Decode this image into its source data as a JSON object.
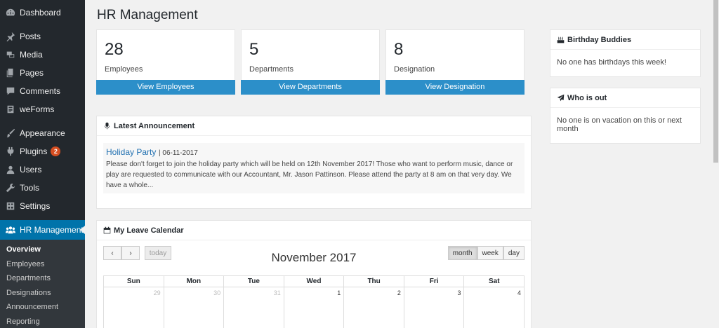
{
  "sidebar": {
    "items": [
      {
        "label": "Dashboard",
        "icon": "dashboard-icon"
      },
      {
        "label": "Posts",
        "icon": "pin-icon"
      },
      {
        "label": "Media",
        "icon": "media-icon"
      },
      {
        "label": "Pages",
        "icon": "pages-icon"
      },
      {
        "label": "Comments",
        "icon": "comment-icon"
      },
      {
        "label": "weForms",
        "icon": "weforms-icon"
      },
      {
        "label": "Appearance",
        "icon": "brush-icon"
      },
      {
        "label": "Plugins",
        "icon": "plugin-icon",
        "badge": "2"
      },
      {
        "label": "Users",
        "icon": "user-icon"
      },
      {
        "label": "Tools",
        "icon": "wrench-icon"
      },
      {
        "label": "Settings",
        "icon": "settings-icon"
      }
    ],
    "active": {
      "label": "HR Management",
      "icon": "group-icon"
    },
    "submenu": [
      "Overview",
      "Employees",
      "Departments",
      "Designations",
      "Announcement",
      "Reporting"
    ]
  },
  "page": {
    "title": "HR Management"
  },
  "stats": [
    {
      "value": "28",
      "label": "Employees",
      "button": "View Employees"
    },
    {
      "value": "5",
      "label": "Departments",
      "button": "View Departments"
    },
    {
      "value": "8",
      "label": "Designation",
      "button": "View Designation"
    }
  ],
  "announcement": {
    "heading": "Latest Announcement",
    "title": "Holiday Party",
    "date": "| 06-11-2017",
    "text": "Please don't forget to join the holiday party which will be held on 12th November 2017! Those who want to perform music, dance or play are requested to communicate with our Accountant, Mr. Jason Pattinson. Please attend the party at 8 am on that very day. We have a whole..."
  },
  "calendar": {
    "heading": "My Leave Calendar",
    "title": "November 2017",
    "prev": "‹",
    "next": "›",
    "today": "today",
    "views": [
      "month",
      "week",
      "day"
    ],
    "days": [
      "Sun",
      "Mon",
      "Tue",
      "Wed",
      "Thu",
      "Fri",
      "Sat"
    ],
    "first_row": [
      "29",
      "30",
      "31",
      "1",
      "2",
      "3",
      "4"
    ]
  },
  "birthday": {
    "heading": "Birthday Buddies",
    "text": "No one has birthdays this week!"
  },
  "whoisout": {
    "heading": "Who is out",
    "text": "No one is on vacation on this or next month"
  }
}
